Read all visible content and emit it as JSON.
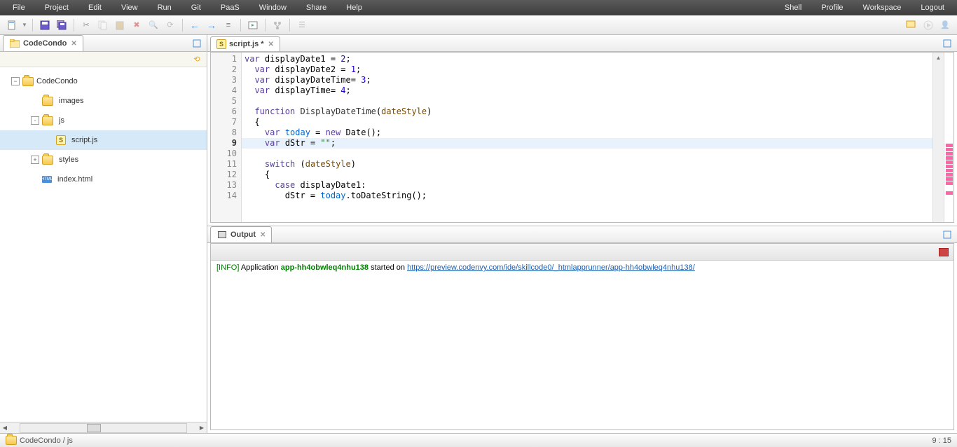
{
  "menu": {
    "left": [
      "File",
      "Project",
      "Edit",
      "View",
      "Run",
      "Git",
      "PaaS",
      "Window",
      "Share",
      "Help"
    ],
    "right": [
      "Shell",
      "Profile",
      "Workspace",
      "Logout"
    ]
  },
  "sidebar": {
    "tab": "CodeCondo",
    "root": "CodeCondo",
    "items": [
      {
        "label": "images",
        "type": "folder",
        "indent": 1,
        "expander": ""
      },
      {
        "label": "js",
        "type": "folder",
        "indent": 1,
        "expander": "-"
      },
      {
        "label": "script.js",
        "type": "js",
        "indent": 2,
        "expander": "",
        "selected": true
      },
      {
        "label": "styles",
        "type": "folder",
        "indent": 1,
        "expander": "+"
      },
      {
        "label": "index.html",
        "type": "html",
        "indent": 1,
        "expander": ""
      }
    ]
  },
  "editor": {
    "tab": "script.js *",
    "lines": [
      {
        "n": 1,
        "html": "<span class='kw'>var</span> displayDate1 = <span class='num'>2</span>;"
      },
      {
        "n": 2,
        "html": "  <span class='kw'>var</span> displayDate2 = <span class='num'>1</span>;"
      },
      {
        "n": 3,
        "html": "  <span class='kw'>var</span> displayDateTime= <span class='num'>3</span>;"
      },
      {
        "n": 4,
        "html": "  <span class='kw'>var</span> displayTime= <span class='num'>4</span>;"
      },
      {
        "n": 5,
        "html": ""
      },
      {
        "n": 6,
        "html": "  <span class='kw'>function</span> <span class='fname'>DisplayDateTime</span>(<span class='arg'>dateStyle</span>)"
      },
      {
        "n": 7,
        "html": "  {"
      },
      {
        "n": 8,
        "html": "    <span class='kw'>var</span> <span class='obj'>today</span> = <span class='kw'>new</span> Date();"
      },
      {
        "n": 9,
        "html": "    <span class='kw'>var</span> dStr = <span class='str'>\"\"</span>;",
        "current": true
      },
      {
        "n": 10,
        "html": ""
      },
      {
        "n": 11,
        "html": "    <span class='kw'>switch</span> (<span class='arg'>dateStyle</span>)"
      },
      {
        "n": 12,
        "html": "    {"
      },
      {
        "n": 13,
        "html": "      <span class='kw'>case</span> displayDate1:"
      },
      {
        "n": 14,
        "html": "        dStr = <span class='obj'>today</span>.toDateString();"
      }
    ],
    "overview_marks": [
      130,
      136,
      142,
      148,
      154,
      160,
      166,
      172,
      178,
      184,
      198
    ]
  },
  "output": {
    "tab": "Output",
    "info_prefix": "[INFO]",
    "info_text": "Application",
    "app_name": "app-hh4obwleq4nhu138",
    "started": "started on",
    "url": "https://preview.codenvy.com/ide/skillcode0/_htmlapprunner/app-hh4obwleq4nhu138/"
  },
  "status": {
    "path": "CodeCondo / js",
    "cursor": "9 : 15"
  }
}
